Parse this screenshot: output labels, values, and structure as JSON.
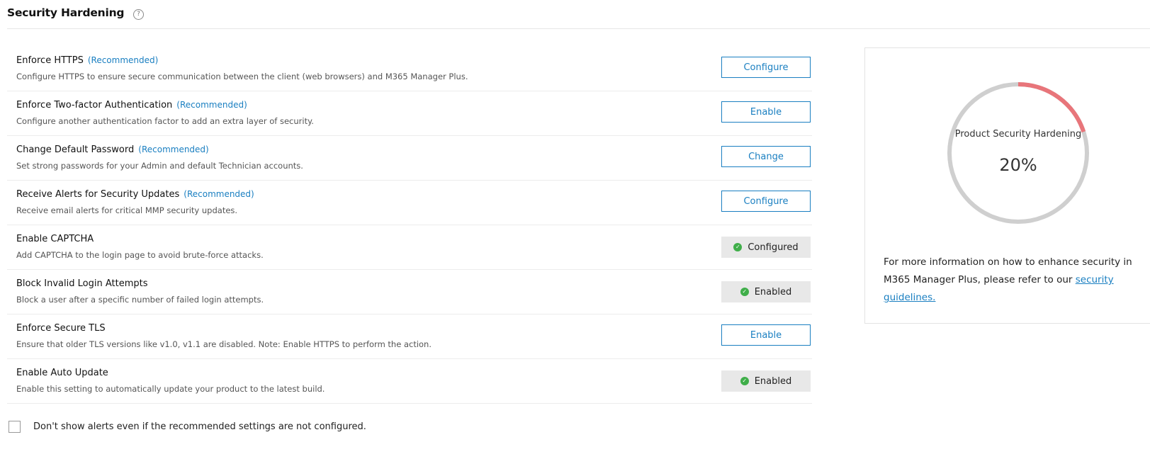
{
  "header": {
    "title": "Security Hardening",
    "help_icon": "help-circle-icon",
    "help_glyph": "?"
  },
  "rows": [
    {
      "title": "Enforce HTTPS",
      "recommended": "(Recommended)",
      "desc": "Configure HTTPS to ensure secure communication between the client (web browsers) and M365 Manager Plus.",
      "action": "Configure",
      "state": "button"
    },
    {
      "title": "Enforce Two-factor Authentication",
      "recommended": "(Recommended)",
      "desc": "Configure another authentication factor to add an extra layer of security.",
      "action": "Enable",
      "state": "button"
    },
    {
      "title": "Change Default Password",
      "recommended": "(Recommended)",
      "desc": "Set strong passwords for your Admin and default Technician accounts.",
      "action": "Change",
      "state": "button"
    },
    {
      "title": "Receive Alerts for Security Updates",
      "recommended": "(Recommended)",
      "desc": "Receive email alerts for critical MMP security updates.",
      "action": "Configure",
      "state": "button"
    },
    {
      "title": "Enable CAPTCHA",
      "recommended": "",
      "desc": "Add CAPTCHA to the login page to avoid brute-force attacks.",
      "action": "Configured",
      "state": "status"
    },
    {
      "title": "Block Invalid Login Attempts",
      "recommended": "",
      "desc": "Block a user after a specific number of failed login attempts.",
      "action": "Enabled",
      "state": "status"
    },
    {
      "title": "Enforce Secure TLS",
      "recommended": "",
      "desc": "Ensure that older TLS versions like v1.0, v1.1 are disabled. Note: Enable HTTPS to perform the action.",
      "action": "Enable",
      "state": "button"
    },
    {
      "title": "Enable Auto Update",
      "recommended": "",
      "desc": "Enable this setting to automatically update your product to the latest build.",
      "action": "Enabled",
      "state": "status"
    }
  ],
  "footer": {
    "checkbox_label": "Don't show alerts even if the recommended settings are not configured."
  },
  "panel": {
    "gauge_label": "Product Security Hardening",
    "gauge_value": "20%",
    "gauge_fraction": 0.2,
    "info_text": "For more information on how to enhance security in M365 Manager Plus, please refer to our ",
    "link_text": "security guidelines."
  },
  "colors": {
    "accent": "#1a7fc1",
    "gauge_fill": "#e8757a",
    "gauge_track": "#cfcfcf",
    "status_ok": "#3fae49"
  }
}
